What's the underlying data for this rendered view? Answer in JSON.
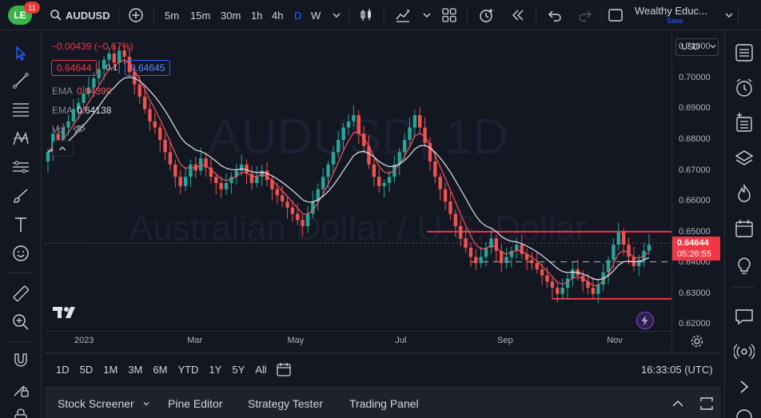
{
  "header": {
    "logo_text": "LE",
    "notification_count": "11",
    "symbol": "AUDUSD",
    "intervals": [
      "5m",
      "15m",
      "30m",
      "1h",
      "4h",
      "D",
      "W"
    ],
    "active_interval": "D",
    "layout_name": "Wealthy Educ...",
    "save_label": "Save"
  },
  "legend": {
    "change": "−0.00439 (−0.67%)",
    "bid": "0.64644",
    "spread": "0.1",
    "ask": "0.64645",
    "ema1_label": "EMA",
    "ema1_value": "0.64399",
    "ema2_label": "EMA",
    "ema2_value": "0.64138",
    "vol_label": "Vol"
  },
  "watermark": {
    "symbol": "AUDUSD, 1D",
    "name": "Australian Dollar / U.S. Dollar"
  },
  "price_axis": {
    "currency": "USD",
    "ticks": [
      "0.71000",
      "0.70000",
      "0.69000",
      "0.68000",
      "0.67000",
      "0.66000",
      "0.65000",
      "0.64000",
      "0.63000",
      "0.62000"
    ],
    "last_price": "0.64644",
    "countdown": "05:26:55"
  },
  "time_axis": {
    "ticks": [
      "2023",
      "Mar",
      "May",
      "Jul",
      "Sep",
      "Nov"
    ]
  },
  "bottom_bar": {
    "periods": [
      "1D",
      "5D",
      "1M",
      "3M",
      "6M",
      "YTD",
      "1Y",
      "5Y",
      "All"
    ],
    "clock": "16:33:05 (UTC)"
  },
  "panel": {
    "tabs": [
      "Stock Screener",
      "Pine Editor",
      "Strategy Tester",
      "Trading Panel"
    ]
  },
  "colors": {
    "up": "#26a69a",
    "down": "#ef5350",
    "accent": "#2962ff",
    "last_price_bg": "#f23645",
    "ema_fast": "#f7525f",
    "ema_slow": "#e0e3eb",
    "resistance": "#f23645"
  },
  "chart_data": {
    "type": "candlestick",
    "symbol": "AUDUSD",
    "interval": "1D",
    "ylim": [
      0.618,
      0.7145
    ],
    "x_ticks": [
      "2023",
      "Mar",
      "May",
      "Jul",
      "Sep",
      "Nov"
    ],
    "last_price": 0.64644,
    "horizontal_lines": [
      {
        "price": 0.6502,
        "style": "solid",
        "color": "#f23645"
      },
      {
        "price": 0.6404,
        "style": "dashed",
        "color": "#b2b5be"
      },
      {
        "price": 0.6284,
        "style": "solid",
        "color": "#f23645"
      },
      {
        "price": 0.64644,
        "style": "dotted",
        "color": "#f23645"
      }
    ],
    "closes": [
      0.676,
      0.682,
      0.68,
      0.684,
      0.686,
      0.69,
      0.692,
      0.695,
      0.697,
      0.7,
      0.703,
      0.706,
      0.708,
      0.705,
      0.709,
      0.707,
      0.702,
      0.698,
      0.694,
      0.69,
      0.686,
      0.684,
      0.68,
      0.676,
      0.672,
      0.668,
      0.665,
      0.668,
      0.672,
      0.67,
      0.674,
      0.671,
      0.668,
      0.666,
      0.664,
      0.666,
      0.668,
      0.67,
      0.672,
      0.669,
      0.666,
      0.668,
      0.67,
      0.667,
      0.664,
      0.662,
      0.66,
      0.658,
      0.656,
      0.654,
      0.652,
      0.656,
      0.66,
      0.664,
      0.668,
      0.672,
      0.676,
      0.68,
      0.684,
      0.686,
      0.688,
      0.682,
      0.678,
      0.672,
      0.668,
      0.665,
      0.666,
      0.668,
      0.672,
      0.676,
      0.68,
      0.684,
      0.688,
      0.684,
      0.679,
      0.673,
      0.668,
      0.664,
      0.66,
      0.656,
      0.652,
      0.648,
      0.645,
      0.642,
      0.64,
      0.642,
      0.645,
      0.648,
      0.644,
      0.64,
      0.642,
      0.644,
      0.646,
      0.643,
      0.641,
      0.64,
      0.638,
      0.636,
      0.634,
      0.632,
      0.63,
      0.632,
      0.635,
      0.638,
      0.636,
      0.634,
      0.632,
      0.63,
      0.633,
      0.637,
      0.641,
      0.646,
      0.65,
      0.646,
      0.642,
      0.639,
      0.641,
      0.644,
      0.646
    ]
  }
}
